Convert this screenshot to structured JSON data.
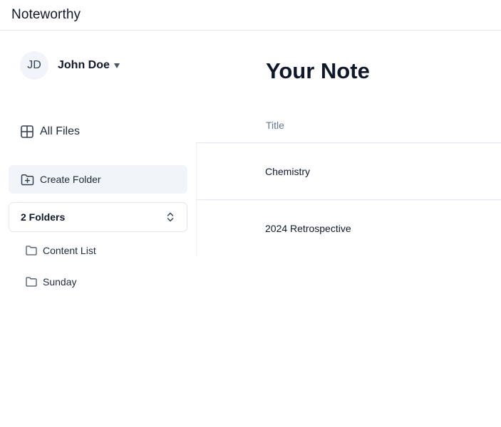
{
  "app": {
    "name": "Noteworthy"
  },
  "user": {
    "initials": "JD",
    "name": "John Doe"
  },
  "sidebar": {
    "all_files_label": "All Files",
    "create_folder_label": "Create Folder",
    "folders_select_label": "2 Folders",
    "folders": [
      {
        "name": "Content List"
      },
      {
        "name": "Sunday"
      }
    ]
  },
  "main": {
    "title": "Your Note",
    "table": {
      "columns": [
        "Title"
      ],
      "rows": [
        {
          "title": "Chemistry"
        },
        {
          "title": "2024 Retrospective"
        }
      ]
    }
  },
  "colors": {
    "accent_bg": "#f1f5f9",
    "border": "#e2e8f0",
    "text": "#0f172a",
    "muted": "#64748b"
  },
  "icons": [
    "caret-down-icon",
    "grid-icon",
    "folder-plus-icon",
    "chevrons-up-down-icon",
    "folder-icon"
  ]
}
